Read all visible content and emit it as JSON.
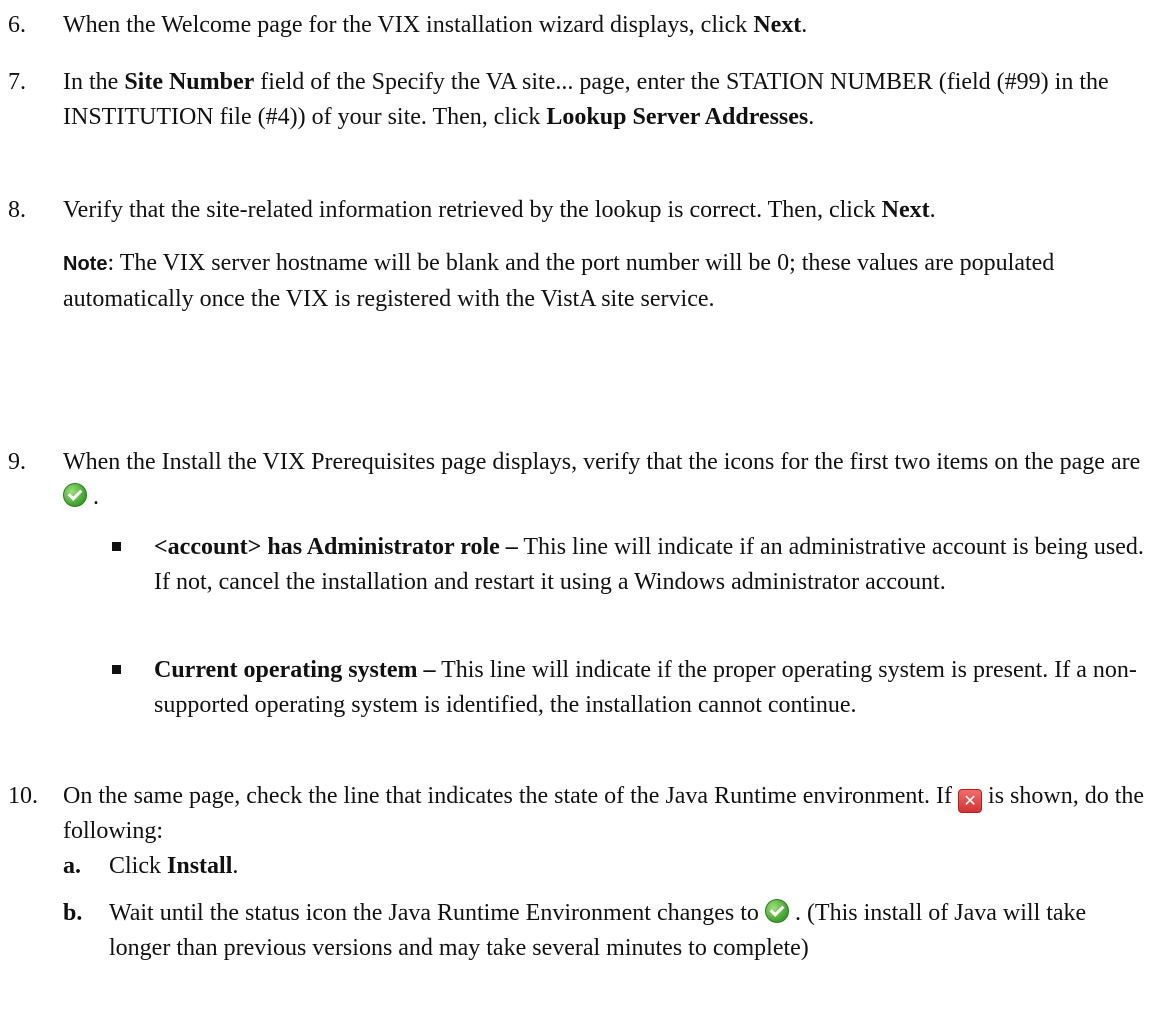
{
  "steps": [
    {
      "number": "6.",
      "parts": [
        "When the Welcome page for the VIX installation wizard displays, click ",
        "Next",
        "."
      ]
    },
    {
      "number": "7.",
      "parts": [
        "In the ",
        "Site Number",
        " field of the Specify the VA site... page, enter the STATION NUMBER (field (#99) in the INSTITUTION file (#4)) of your site. Then, click ",
        "Lookup Server Addresses",
        "."
      ]
    },
    {
      "number": "8.",
      "parts": [
        "Verify that the site-related information retrieved by the lookup is correct. Then, click ",
        "Next",
        "."
      ],
      "note_label": "Note",
      "note_text": ": The VIX server hostname will be blank and the port number will be 0; these values are populated automatically once the VIX is registered with the VistA site service."
    },
    {
      "number": "9.",
      "text_before_icon": "When the Install the VIX Prerequisites page displays, verify that the icons for the first two items on the page are",
      "text_after_icon": " .",
      "icon": "green-check-icon",
      "bullets": [
        {
          "bold": "<account> has Administrator role –",
          "text": " This line will indicate if an administrative account is being used. If not, cancel the installation and restart it using a Windows administrator account."
        },
        {
          "bold": "Current operating system –",
          "text": " This line will indicate if the proper operating system is present. If a non-supported operating system is identified, the installation cannot continue."
        }
      ]
    },
    {
      "number": "10.",
      "text_before_icon": "On the same page, check the line that indicates the state of the Java Runtime environment. If ",
      "text_after_icon": " is shown, do the following:",
      "icon": "red-x-icon",
      "substeps": [
        {
          "letter": "a.",
          "parts": [
            "Click ",
            "Install",
            "."
          ]
        },
        {
          "letter": "b.",
          "text_before_icon": "Wait until the status icon the Java Runtime Environment changes to ",
          "text_after_icon": " . (This install of Java will take longer than previous versions and may take several minutes to complete)",
          "icon": "green-check-icon"
        }
      ]
    }
  ],
  "colors": {
    "text": "#111111",
    "check_green": "#3d9f2a",
    "x_red": "#d23333"
  }
}
